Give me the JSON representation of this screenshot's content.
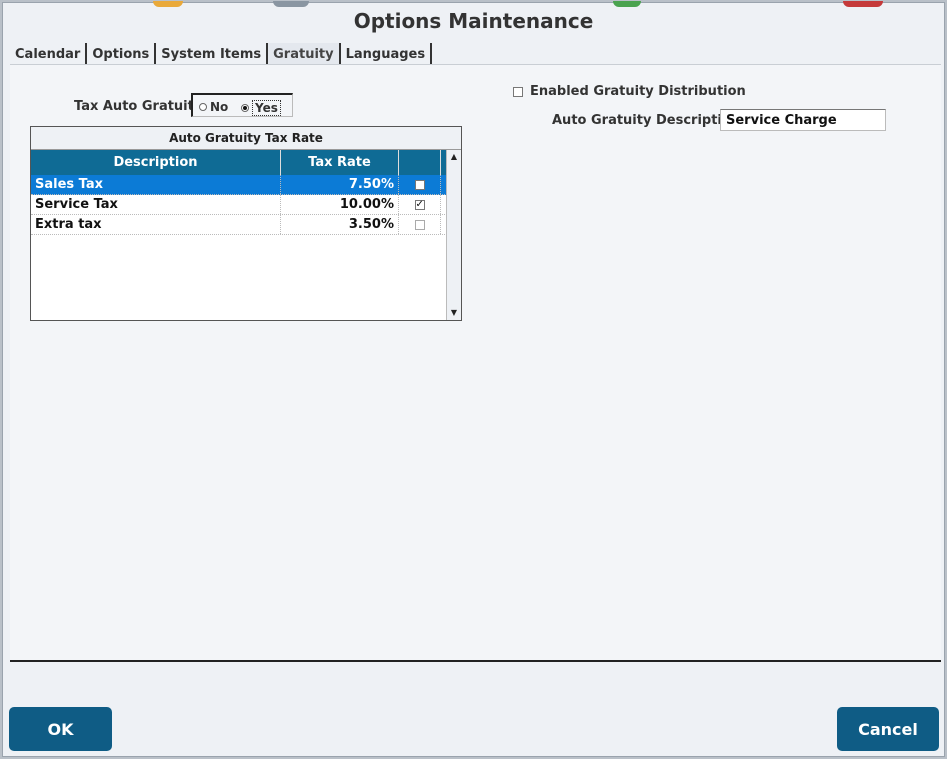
{
  "window": {
    "title": "Options Maintenance"
  },
  "tabs": [
    {
      "label": "Calendar"
    },
    {
      "label": "Options"
    },
    {
      "label": "System Items"
    },
    {
      "label": "Gratuity",
      "active": true
    },
    {
      "label": "Languages"
    }
  ],
  "gratuity": {
    "tax_auto_label": "Tax Auto Gratuity",
    "radio_no": "No",
    "radio_yes": "Yes",
    "selected": "Yes",
    "grid": {
      "title": "Auto Gratuity Tax Rate",
      "columns": [
        "Description",
        "Tax Rate",
        ""
      ],
      "rows": [
        {
          "description": "Sales Tax",
          "rate": "7.50%",
          "checked": false
        },
        {
          "description": "Service Tax",
          "rate": "10.00%",
          "checked": true
        },
        {
          "description": "Extra tax",
          "rate": "3.50%",
          "checked": false
        }
      ]
    },
    "enabled_distribution_label": "Enabled Gratuity Distribution",
    "enabled_distribution_checked": false,
    "auto_desc_label": "Auto Gratuity Description",
    "auto_desc_value": "Service Charge"
  },
  "buttons": {
    "ok": "OK",
    "cancel": "Cancel"
  },
  "colors": {
    "accent": "#0f5c85",
    "header": "#0f6b95",
    "selection": "#0c7bd6"
  }
}
